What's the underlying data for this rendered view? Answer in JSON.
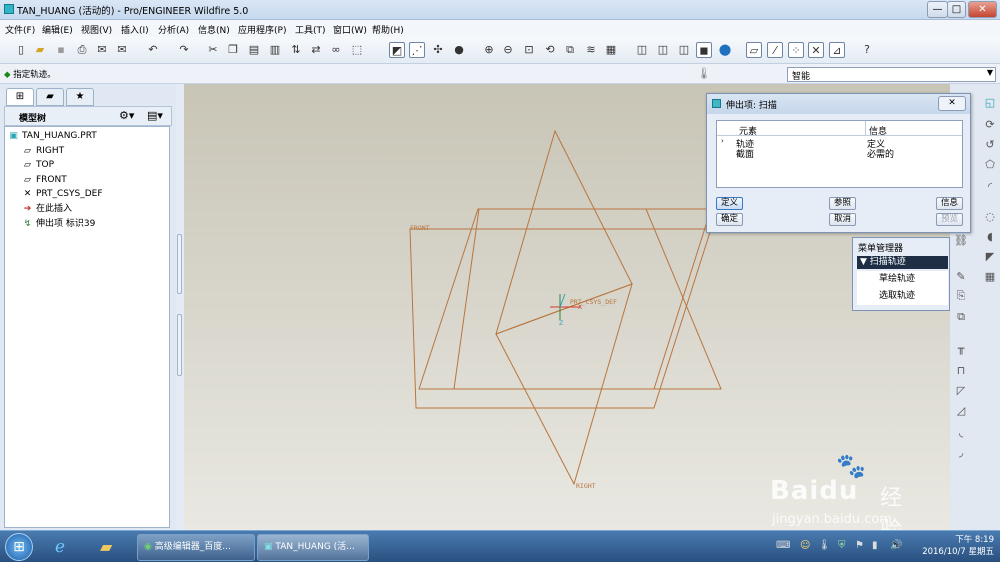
{
  "window": {
    "title": "TAN_HUANG (活动的) - Pro/ENGINEER Wildfire 5.0",
    "minimize": "—",
    "maximize": "□",
    "close": "✕"
  },
  "menu": [
    "文件(F)",
    "编辑(E)",
    "视图(V)",
    "插入(I)",
    "分析(A)",
    "信息(N)",
    "应用程序(P)",
    "工具(T)",
    "窗口(W)",
    "帮助(H)"
  ],
  "status": {
    "message": "指定轨迹。",
    "filter": "智能"
  },
  "model_tree": {
    "header": "模型树",
    "items": [
      {
        "label": "TAN_HUANG.PRT",
        "icon": "part-icon"
      },
      {
        "label": "RIGHT",
        "icon": "datum-plane-icon"
      },
      {
        "label": "TOP",
        "icon": "datum-plane-icon"
      },
      {
        "label": "FRONT",
        "icon": "datum-plane-icon"
      },
      {
        "label": "PRT_CSYS_DEF",
        "icon": "csys-icon"
      },
      {
        "label": "在此插入",
        "icon": "insert-arrow-icon"
      },
      {
        "label": "伸出项 标识39",
        "icon": "protrusion-icon"
      }
    ]
  },
  "viewport": {
    "front_label": "FRONT",
    "right_label": "RIGHT",
    "csys_label": "PRT_CSYS_DEF",
    "axis_z": "Z",
    "axis_x": "X",
    "line_color": "#b8763f"
  },
  "sweep_dialog": {
    "title": "伸出项: 扫描",
    "columns": [
      "元素",
      "信息"
    ],
    "rows": [
      {
        "element": "轨迹",
        "info": "定义"
      },
      {
        "element": "截面",
        "info": "必需的"
      }
    ],
    "buttons": {
      "define": "定义",
      "reference": "参照",
      "info": "信息",
      "ok": "确定",
      "cancel": "取消",
      "preview": "预览"
    }
  },
  "menu_manager": {
    "title": "菜单管理器",
    "selected": "扫描轨迹",
    "options": [
      "草绘轨迹",
      "选取轨迹"
    ]
  },
  "taskbar": {
    "tasks": [
      "高级编辑器_百度...",
      "TAN_HUANG (活..."
    ],
    "clock_ampm": "下午 8:19",
    "date": "2016/10/7 星期五"
  },
  "watermark": {
    "brand": "Baidu",
    "cn": "经验",
    "url": "jingyan.baidu.com"
  }
}
